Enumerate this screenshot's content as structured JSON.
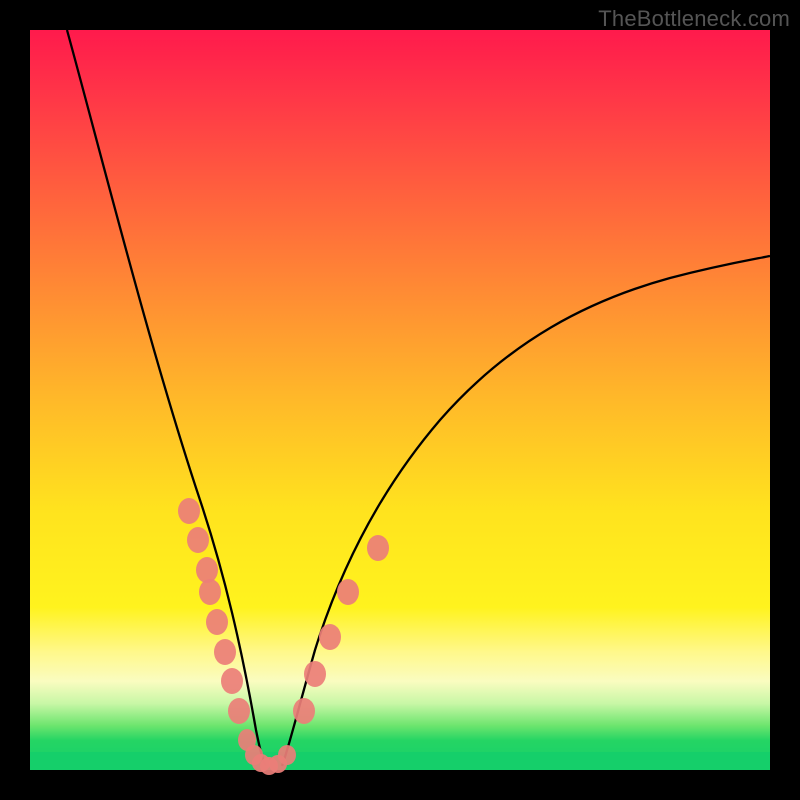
{
  "watermark": "TheBottleneck.com",
  "colors": {
    "background": "#000000",
    "gradient_top": "#ff1a4c",
    "gradient_mid": "#ffe31e",
    "gradient_bottom": "#15cf6a",
    "curve": "#000000",
    "dots": "#ec7e78"
  },
  "chart_data": {
    "type": "line",
    "title": "",
    "xlabel": "",
    "ylabel": "",
    "xlim": [
      0,
      100
    ],
    "ylim": [
      0,
      100
    ],
    "series": [
      {
        "name": "left-curve",
        "x": [
          5,
          8,
          11,
          14,
          17,
          20,
          22,
          24,
          26,
          27.5,
          29,
          30,
          30.8
        ],
        "y": [
          100,
          86,
          73,
          61,
          50,
          40,
          32,
          25,
          18,
          12,
          7,
          3,
          0.5
        ]
      },
      {
        "name": "right-curve",
        "x": [
          33.5,
          35,
          37,
          40,
          44,
          49,
          55,
          62,
          70,
          79,
          89,
          100
        ],
        "y": [
          0.5,
          3,
          8,
          15,
          23,
          31,
          39,
          46,
          53,
          59,
          64,
          68
        ]
      }
    ],
    "scatter": [
      {
        "name": "dots-left-branch",
        "points": [
          {
            "x": 21.5,
            "y": 35
          },
          {
            "x": 22.7,
            "y": 31
          },
          {
            "x": 23.9,
            "y": 27
          },
          {
            "x": 24.3,
            "y": 24
          },
          {
            "x": 25.3,
            "y": 20
          },
          {
            "x": 26.3,
            "y": 16
          },
          {
            "x": 27.3,
            "y": 12
          },
          {
            "x": 28.3,
            "y": 8
          }
        ]
      },
      {
        "name": "dots-trough",
        "points": [
          {
            "x": 29.3,
            "y": 4
          },
          {
            "x": 30.3,
            "y": 2
          },
          {
            "x": 31.3,
            "y": 1
          },
          {
            "x": 32.3,
            "y": 0.5
          },
          {
            "x": 33.5,
            "y": 0.8
          },
          {
            "x": 34.7,
            "y": 2
          }
        ]
      },
      {
        "name": "dots-right-branch",
        "points": [
          {
            "x": 37,
            "y": 8
          },
          {
            "x": 38.5,
            "y": 13
          },
          {
            "x": 40.5,
            "y": 18
          },
          {
            "x": 43,
            "y": 24
          },
          {
            "x": 47,
            "y": 30
          }
        ]
      }
    ]
  }
}
